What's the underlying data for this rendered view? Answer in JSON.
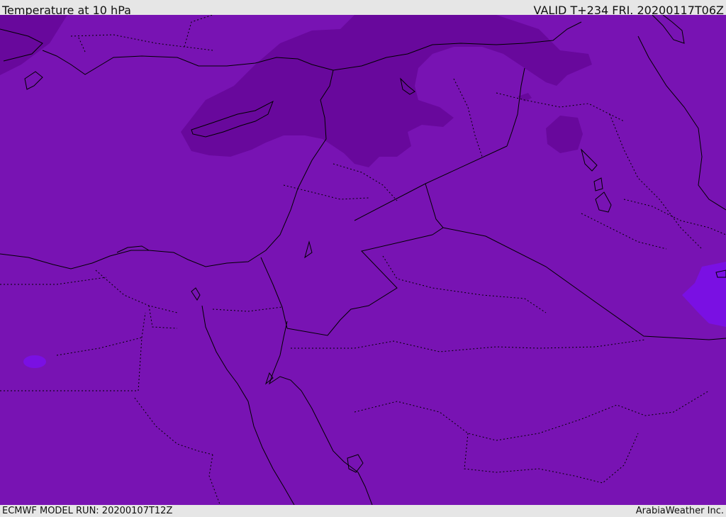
{
  "header": {
    "title": "Temperature at 10 hPa",
    "valid": "VALID T+234 FRI. 20200117T06Z"
  },
  "footer": {
    "model_run": "ECMWF MODEL RUN: 20200107T12Z",
    "credit": "ArabiaWeather Inc."
  },
  "map": {
    "colors": {
      "base": "#7813b3",
      "cold": "#68089c",
      "warm": "#7a10e3",
      "coastline": "#000000"
    }
  }
}
